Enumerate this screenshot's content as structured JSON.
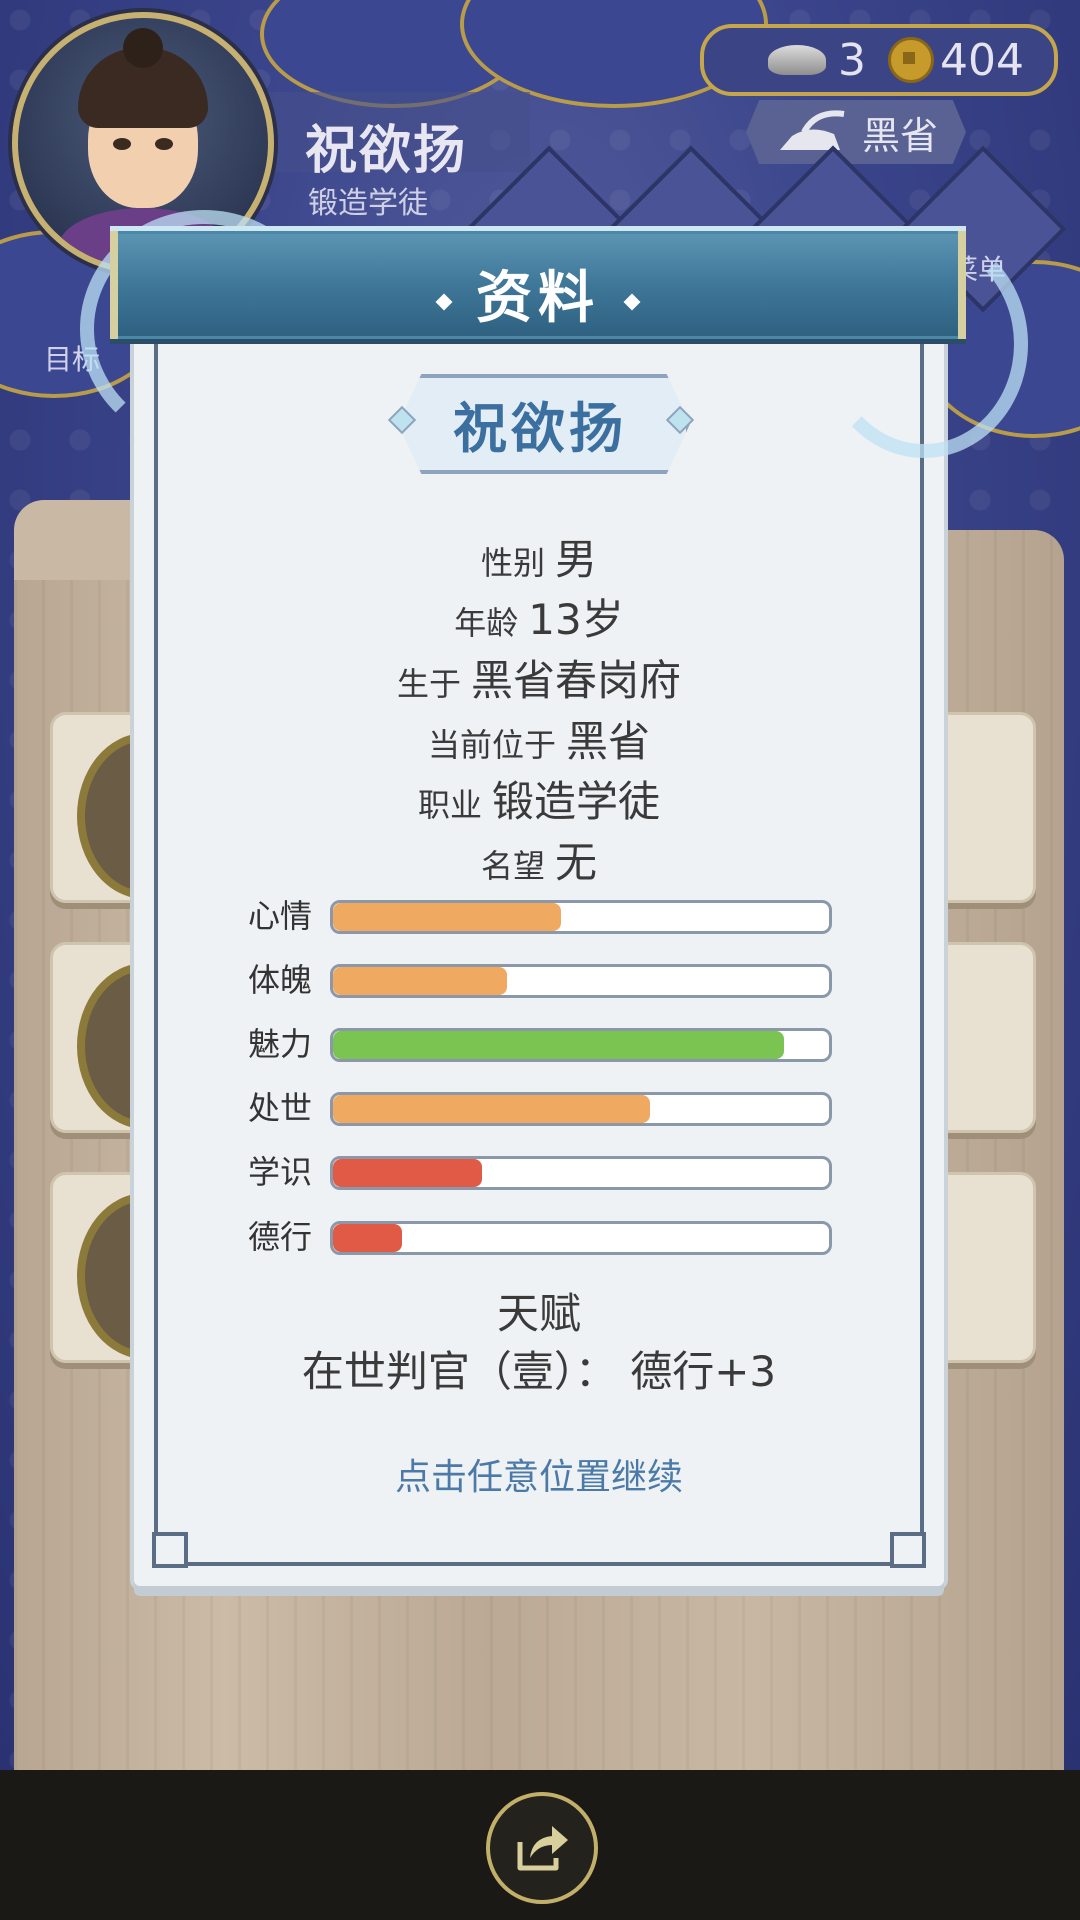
{
  "hud": {
    "player_name": "祝欲扬",
    "player_title": "锻造学徒",
    "silver_ingots": "3",
    "coins": "404",
    "location": "黑省",
    "peek_left": "目标",
    "peek_right": "菜单"
  },
  "modal": {
    "title": "资料",
    "name": "祝欲扬",
    "info": [
      {
        "key": "性别",
        "value": "男"
      },
      {
        "key": "年龄",
        "value": "13岁"
      },
      {
        "key": "生于",
        "value": "黑省春岗府"
      },
      {
        "key": "当前位于",
        "value": "黑省"
      },
      {
        "key": "职业",
        "value": "锻造学徒"
      },
      {
        "key": "名望",
        "value": "无"
      }
    ],
    "stats": [
      {
        "label": "心情",
        "level": 0.46,
        "color": "#f0a960"
      },
      {
        "label": "体魄",
        "level": 0.35,
        "color": "#f0a960"
      },
      {
        "label": "魅力",
        "level": 0.91,
        "color": "#7cc451"
      },
      {
        "label": "处世",
        "level": 0.64,
        "color": "#f0a960"
      },
      {
        "label": "学识",
        "level": 0.3,
        "color": "#e05a45"
      },
      {
        "label": "德行",
        "level": 0.14,
        "color": "#e05a45"
      }
    ],
    "talent_heading": "天赋",
    "talent_text": "在世判官（壹）： 德行+3",
    "continue_hint": "点击任意位置继续"
  }
}
